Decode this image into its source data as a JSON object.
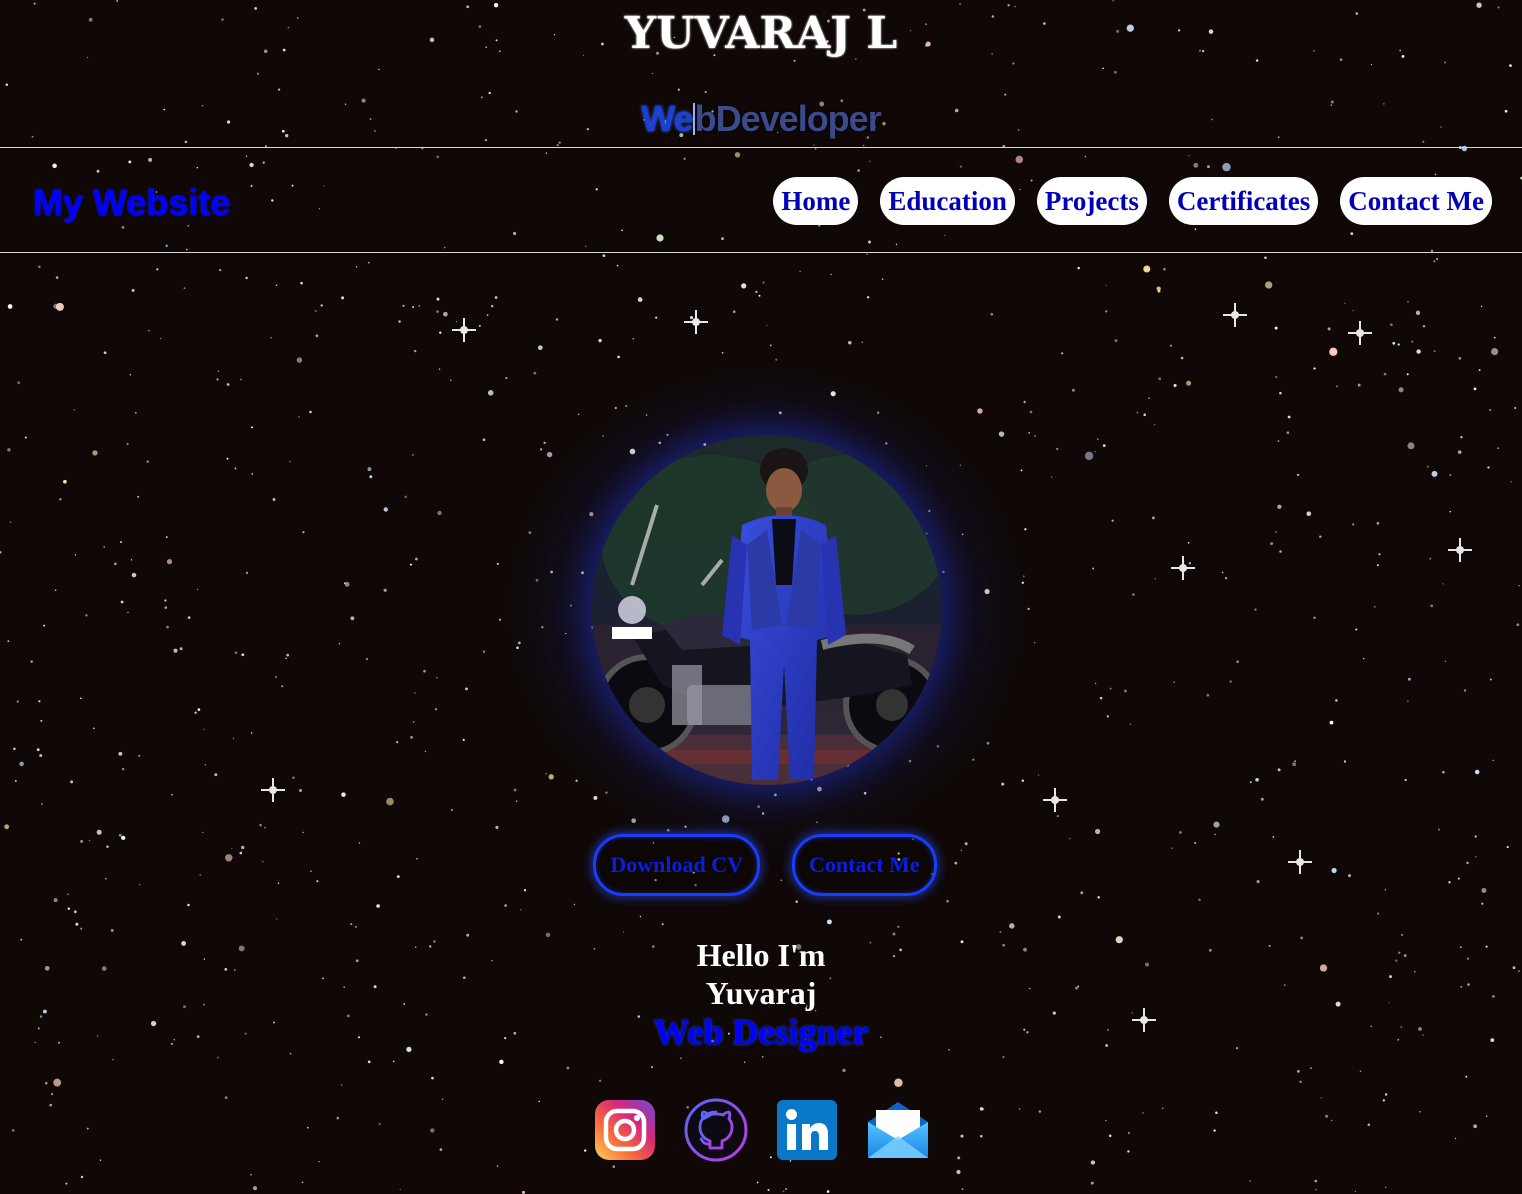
{
  "header": {
    "title": "YUVARAJ L",
    "typed_done": "We",
    "typed_rest": "bDeveloper"
  },
  "nav": {
    "brand": "My Website",
    "links": [
      {
        "label": "Home"
      },
      {
        "label": "Education"
      },
      {
        "label": "Projects"
      },
      {
        "label": "Certificates"
      },
      {
        "label": "Contact Me"
      }
    ]
  },
  "actions": {
    "download_cv": "Download CV",
    "contact_me": "Contact Me"
  },
  "intro": {
    "greeting": "Hello I'm",
    "name": "Yuvaraj",
    "role": "Web Designer"
  },
  "social": [
    {
      "icon": "instagram-icon"
    },
    {
      "icon": "github-icon"
    },
    {
      "icon": "linkedin-icon"
    },
    {
      "icon": "email-icon"
    }
  ],
  "colors": {
    "background": "#0f0806",
    "accent_blue": "#0000ff",
    "nav_text": "#0000b8",
    "button_border": "#1a3cff"
  }
}
